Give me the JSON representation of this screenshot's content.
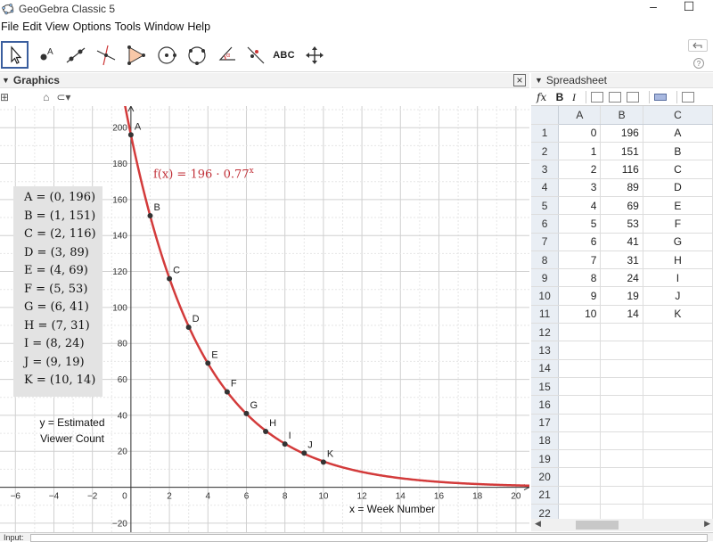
{
  "window": {
    "title": "GeoGebra Classic 5",
    "minimize": "–",
    "maximize": "☐"
  },
  "menu": [
    "File",
    "Edit",
    "View",
    "Options",
    "Tools",
    "Window",
    "Help"
  ],
  "toolbar": {
    "tools": [
      {
        "name": "move-tool",
        "icon": "arrow-pointer-icon"
      },
      {
        "name": "point-tool",
        "icon": "point-icon"
      },
      {
        "name": "line-tool",
        "icon": "line-icon"
      },
      {
        "name": "perpendicular-tool",
        "icon": "perpendicular-icon"
      },
      {
        "name": "polygon-tool",
        "icon": "polygon-icon"
      },
      {
        "name": "circle-tool",
        "icon": "circle-icon"
      },
      {
        "name": "circle-three-points-tool",
        "icon": "circle-3pt-icon"
      },
      {
        "name": "angle-tool",
        "icon": "angle-icon"
      },
      {
        "name": "reflect-tool",
        "icon": "reflect-icon"
      },
      {
        "name": "text-tool",
        "icon": "text-icon",
        "label": "ABC"
      },
      {
        "name": "move-view-tool",
        "icon": "move-arrows-icon"
      }
    ],
    "help": "?"
  },
  "graphics": {
    "header": "Graphics",
    "function_label": "f(x) = 196 · 0.77",
    "function_exponent": "x",
    "y_label_line1": "y = Estimated",
    "y_label_line2": "Viewer Count",
    "x_label": "x = Week Number",
    "points_text": [
      "A = (0, 196)",
      "B = (1, 151)",
      "C = (2, 116)",
      "D = (3, 89)",
      "E = (4, 69)",
      "F = (5, 53)",
      "G = (6, 41)",
      "H = (7, 31)",
      "I = (8, 24)",
      "J = (9, 19)",
      "K = (10, 14)"
    ],
    "curve_color": "#d33b3b",
    "label_color": "#c2323a"
  },
  "chart_data": {
    "type": "scatter",
    "x_ticks": [
      -6,
      -4,
      -2,
      0,
      2,
      4,
      6,
      8,
      10,
      12,
      14,
      16,
      18,
      20
    ],
    "y_ticks": [
      -20,
      20,
      40,
      60,
      80,
      100,
      120,
      140,
      160,
      180,
      200
    ],
    "xlim": [
      -6.8,
      20.7
    ],
    "ylim": [
      -25,
      212
    ],
    "grid": true,
    "function": {
      "a": 196,
      "b": 0.77
    },
    "points": [
      {
        "label": "A",
        "x": 0,
        "y": 196
      },
      {
        "label": "B",
        "x": 1,
        "y": 151
      },
      {
        "label": "C",
        "x": 2,
        "y": 116
      },
      {
        "label": "D",
        "x": 3,
        "y": 89
      },
      {
        "label": "E",
        "x": 4,
        "y": 69
      },
      {
        "label": "F",
        "x": 5,
        "y": 53
      },
      {
        "label": "G",
        "x": 6,
        "y": 41
      },
      {
        "label": "H",
        "x": 7,
        "y": 31
      },
      {
        "label": "I",
        "x": 8,
        "y": 24
      },
      {
        "label": "J",
        "x": 9,
        "y": 19
      },
      {
        "label": "K",
        "x": 10,
        "y": 14
      }
    ]
  },
  "spreadsheet": {
    "header": "Spreadsheet",
    "toolbar": {
      "fx": "fx",
      "bold": "B",
      "italic": "I"
    },
    "columns": [
      "A",
      "B",
      "C"
    ],
    "rows": [
      {
        "n": "1",
        "A": "0",
        "B": "196",
        "C": "A"
      },
      {
        "n": "2",
        "A": "1",
        "B": "151",
        "C": "B"
      },
      {
        "n": "3",
        "A": "2",
        "B": "116",
        "C": "C"
      },
      {
        "n": "4",
        "A": "3",
        "B": "89",
        "C": "D"
      },
      {
        "n": "5",
        "A": "4",
        "B": "69",
        "C": "E"
      },
      {
        "n": "6",
        "A": "5",
        "B": "53",
        "C": "F"
      },
      {
        "n": "7",
        "A": "6",
        "B": "41",
        "C": "G"
      },
      {
        "n": "8",
        "A": "7",
        "B": "31",
        "C": "H"
      },
      {
        "n": "9",
        "A": "8",
        "B": "24",
        "C": "I"
      },
      {
        "n": "10",
        "A": "9",
        "B": "19",
        "C": "J"
      },
      {
        "n": "11",
        "A": "10",
        "B": "14",
        "C": "K"
      },
      {
        "n": "12",
        "A": "",
        "B": "",
        "C": ""
      },
      {
        "n": "13",
        "A": "",
        "B": "",
        "C": ""
      },
      {
        "n": "14",
        "A": "",
        "B": "",
        "C": ""
      },
      {
        "n": "15",
        "A": "",
        "B": "",
        "C": ""
      },
      {
        "n": "16",
        "A": "",
        "B": "",
        "C": ""
      },
      {
        "n": "17",
        "A": "",
        "B": "",
        "C": ""
      },
      {
        "n": "18",
        "A": "",
        "B": "",
        "C": ""
      },
      {
        "n": "19",
        "A": "",
        "B": "",
        "C": ""
      },
      {
        "n": "20",
        "A": "",
        "B": "",
        "C": ""
      },
      {
        "n": "21",
        "A": "",
        "B": "",
        "C": ""
      },
      {
        "n": "22",
        "A": "",
        "B": "",
        "C": ""
      }
    ]
  },
  "input_bar": {
    "label": "Input:"
  }
}
